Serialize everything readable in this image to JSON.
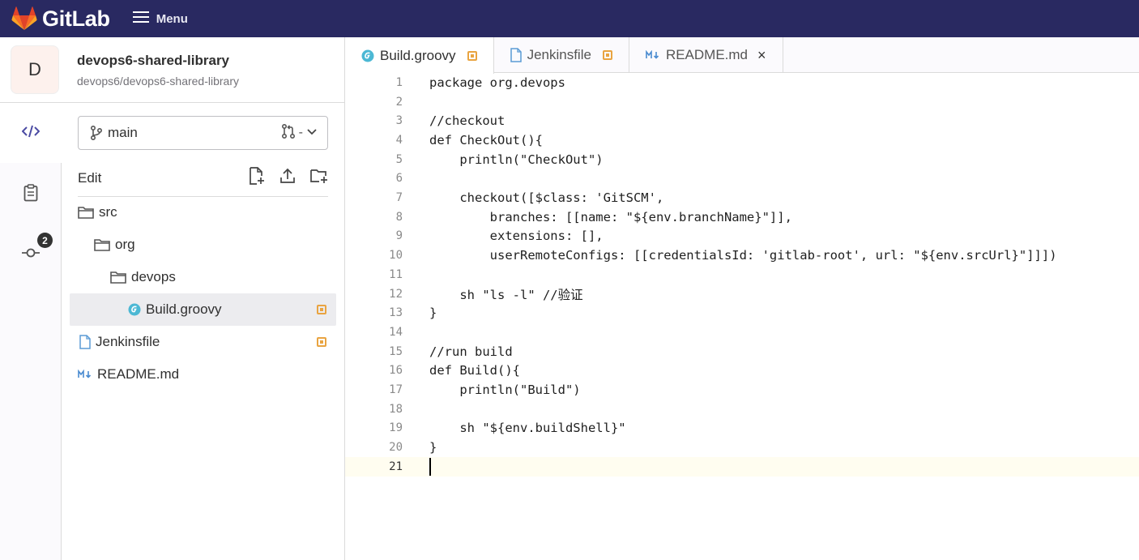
{
  "navbar": {
    "brand": "GitLab",
    "menu_label": "Menu"
  },
  "project": {
    "avatar_letter": "D",
    "name": "devops6-shared-library",
    "path": "devops6/devops6-shared-library"
  },
  "activity": {
    "commit_badge": "2"
  },
  "branch": {
    "name": "main",
    "mr_value": "-"
  },
  "file_panel": {
    "edit_label": "Edit"
  },
  "tree": [
    {
      "label": "src",
      "type": "folder"
    },
    {
      "label": "org",
      "type": "folder"
    },
    {
      "label": "devops",
      "type": "folder"
    },
    {
      "label": "Build.groovy",
      "type": "groovy",
      "modified": true,
      "active": true
    },
    {
      "label": "Jenkinsfile",
      "type": "file",
      "modified": true
    },
    {
      "label": "README.md",
      "type": "markdown"
    }
  ],
  "tabs": [
    {
      "label": "Build.groovy",
      "active": true,
      "modified": true
    },
    {
      "label": "Jenkinsfile",
      "modified": true
    },
    {
      "label": "README.md",
      "closable": true,
      "close_glyph": "×"
    }
  ],
  "editor": {
    "current_line": 21,
    "lines": [
      "package org.devops",
      "",
      "//checkout",
      "def CheckOut(){",
      "    println(\"CheckOut\")",
      "",
      "    checkout([$class: 'GitSCM',",
      "        branches: [[name: \"${env.branchName}\"]],",
      "        extensions: [],",
      "        userRemoteConfigs: [[credentialsId: 'gitlab-root', url: \"${env.srcUrl}\"]]])",
      "",
      "    sh \"ls -l\" //验证",
      "}",
      "",
      "//run build",
      "def Build(){",
      "    println(\"Build\")",
      "",
      "    sh \"${env.buildShell}\"",
      "}",
      ""
    ]
  }
}
